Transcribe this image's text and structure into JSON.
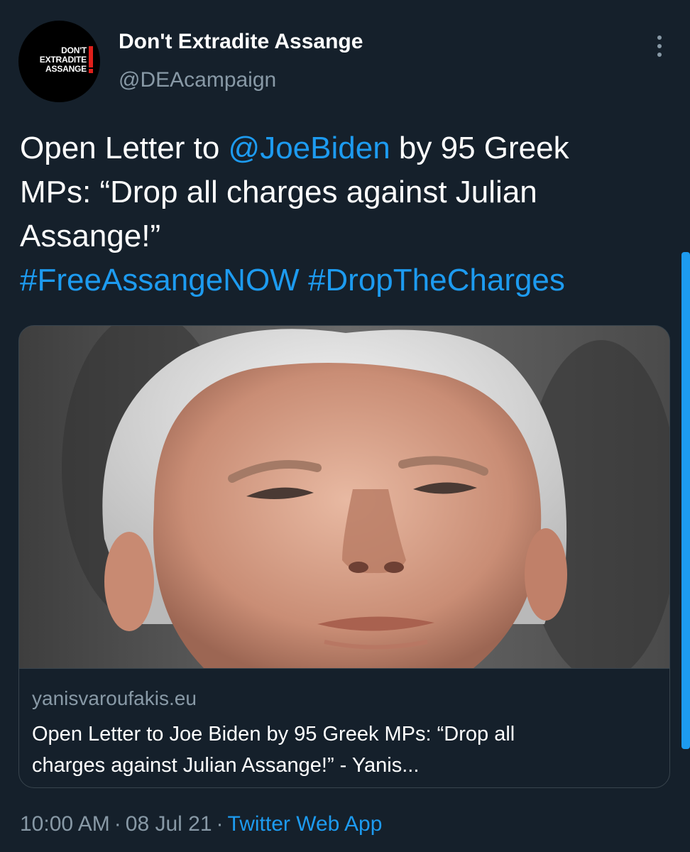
{
  "author": {
    "display_name": "Don't Extradite Assange",
    "handle": "@DEAcampaign",
    "avatar_text": [
      "DON'T",
      "EXTRADITE",
      "ASSANGE"
    ],
    "avatar_icon": "dea-logo"
  },
  "tweet": {
    "text_lines": [
      {
        "before": "Open Letter to ",
        "mention": "@JoeBiden",
        "after": " by 95 Greek"
      },
      {
        "text": "MPs: “Drop all charges against Julian"
      },
      {
        "text": "Assange!”"
      }
    ],
    "hashtags": [
      "#FreeAssangeNOW",
      "#DropTheCharges"
    ]
  },
  "card": {
    "image_icon": "portrait-photo",
    "domain": "yanisvaroufakis.eu",
    "title_lines": [
      "Open Letter to Joe Biden by 95 Greek MPs: “Drop all",
      "charges against Julian Assange!” - Yanis..."
    ]
  },
  "footer": {
    "time": "10:00 AM",
    "separator": "·",
    "date": "08 Jul 21",
    "source": "Twitter Web App"
  },
  "icons": {
    "more": "more-vertical-icon"
  },
  "colors": {
    "background": "#15202b",
    "link": "#1d9bf0",
    "secondary_text": "#8899a6",
    "border": "#38444d",
    "avatar_accent": "#e0201b"
  }
}
